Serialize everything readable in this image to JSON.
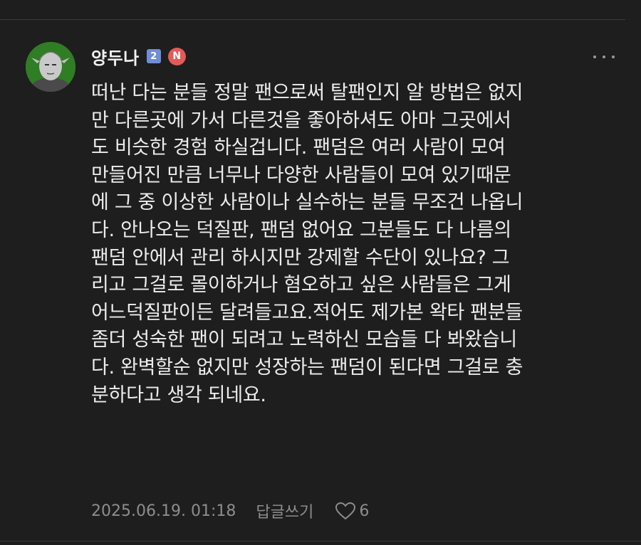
{
  "comment": {
    "author": "양두나",
    "grade_badge": "2",
    "new_badge": "N",
    "body": "떠난 다는 분들 정말 팬으로써 탈팬인지 알 방법은 없지\n만 다른곳에 가서 다른것을 좋아하셔도 아마 그곳에서\n도 비슷한 경험 하실겁니다. 팬덤은 여러 사람이 모여\n만들어진 만큼 너무나 다양한 사람들이 모여 있기때문\n에 그 중 이상한 사람이나 실수하는 분들 무조건 나옵니\n다. 안나오는 덕질판, 팬덤 없어요 그분들도 다 나름의\n팬덤 안에서 관리 하시지만 강제할 수단이 있나요? 그\n리고 그걸로 몰이하거나 혐오하고 싶은 사람들은 그게\n어느덕질판이든 달려들고요.적어도 제가본 왁타 팬분들\n좀더 성숙한 팬이 되려고 노력하신 모습들 다 봐왔습니\n다. 완벽할순 없지만 성장하는 팬덤이 된다면 그걸로 충\n분하다고 생각 되네요.",
    "timestamp": "2025.06.19. 01:18",
    "reply_label": "답글쓰기",
    "like_count": "6"
  },
  "icons": {
    "more": "more-vertical-icon",
    "like": "heart-outline-icon"
  },
  "colors": {
    "background": "#1e1e1e",
    "text": "#ececec",
    "meta_text": "#8d8d8d",
    "grade_badge": "#6f8ed6",
    "new_badge": "#e35a5a"
  }
}
